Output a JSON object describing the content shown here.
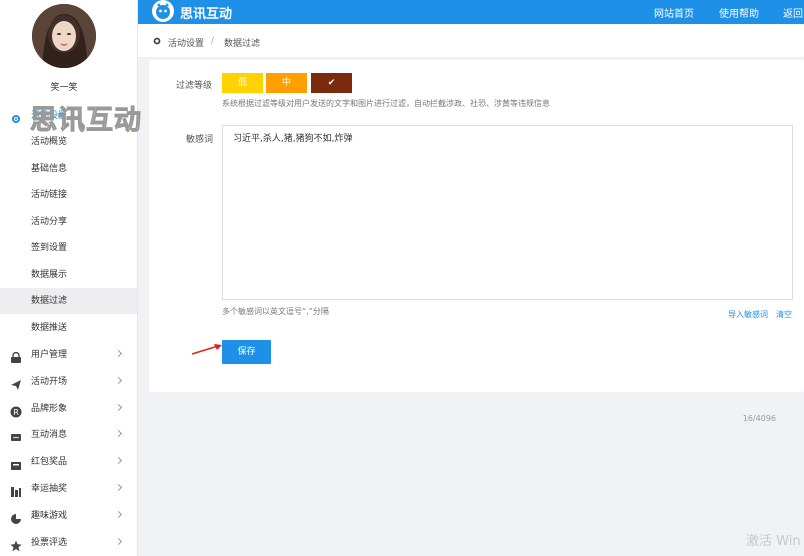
{
  "sidebar": {
    "username": "笑一笑",
    "section_title": "活动设置",
    "sub_items": [
      {
        "label": "活动概览"
      },
      {
        "label": "基础信息"
      },
      {
        "label": "活动链接"
      },
      {
        "label": "活动分享"
      },
      {
        "label": "签到设置"
      },
      {
        "label": "数据展示"
      },
      {
        "label": "数据过滤",
        "active": true
      },
      {
        "label": "数据推送"
      }
    ],
    "groups": [
      {
        "label": "用户管理",
        "icon": "user-lock-icon"
      },
      {
        "label": "活动开场",
        "icon": "paper-plane-icon"
      },
      {
        "label": "品牌形象",
        "icon": "registered-icon"
      },
      {
        "label": "互动消息",
        "icon": "message-icon"
      },
      {
        "label": "红包奖品",
        "icon": "gift-icon"
      },
      {
        "label": "幸运抽奖",
        "icon": "lottery-icon"
      },
      {
        "label": "趣味游戏",
        "icon": "game-icon"
      },
      {
        "label": "投票评选",
        "icon": "star-icon"
      }
    ]
  },
  "header": {
    "logo_text": "思讯互动",
    "nav": [
      "网站首页",
      "使用帮助",
      "返回"
    ],
    "bg_color": "#1e90e8"
  },
  "breadcrumb": {
    "items": [
      "活动设置",
      "数据过滤"
    ],
    "separator": "/"
  },
  "form": {
    "filter_level_label": "过滤等级",
    "levels": [
      {
        "label": "低",
        "color": "#ffd200"
      },
      {
        "label": "中",
        "color": "#ff9f00"
      },
      {
        "label": "✔",
        "color": "#7a2a0d",
        "selected": true
      }
    ],
    "hint": "系统根据过滤等级对用户发送的文字和图片进行过滤，自动拦截涉政、社恐、涉黄等违规信息",
    "sensitive_label": "敏感词",
    "sensitive_value": "习近平,杀人,猪,猪狗不如,炸弹",
    "counter": "16/4096",
    "sensitive_hint": "多个敏感词以英文逗号“,”分隔",
    "import_link": "导入敏感词",
    "clear_link": "清空",
    "save_label": "保存"
  },
  "watermark": "思讯互动",
  "os_watermark": "激活 Win"
}
